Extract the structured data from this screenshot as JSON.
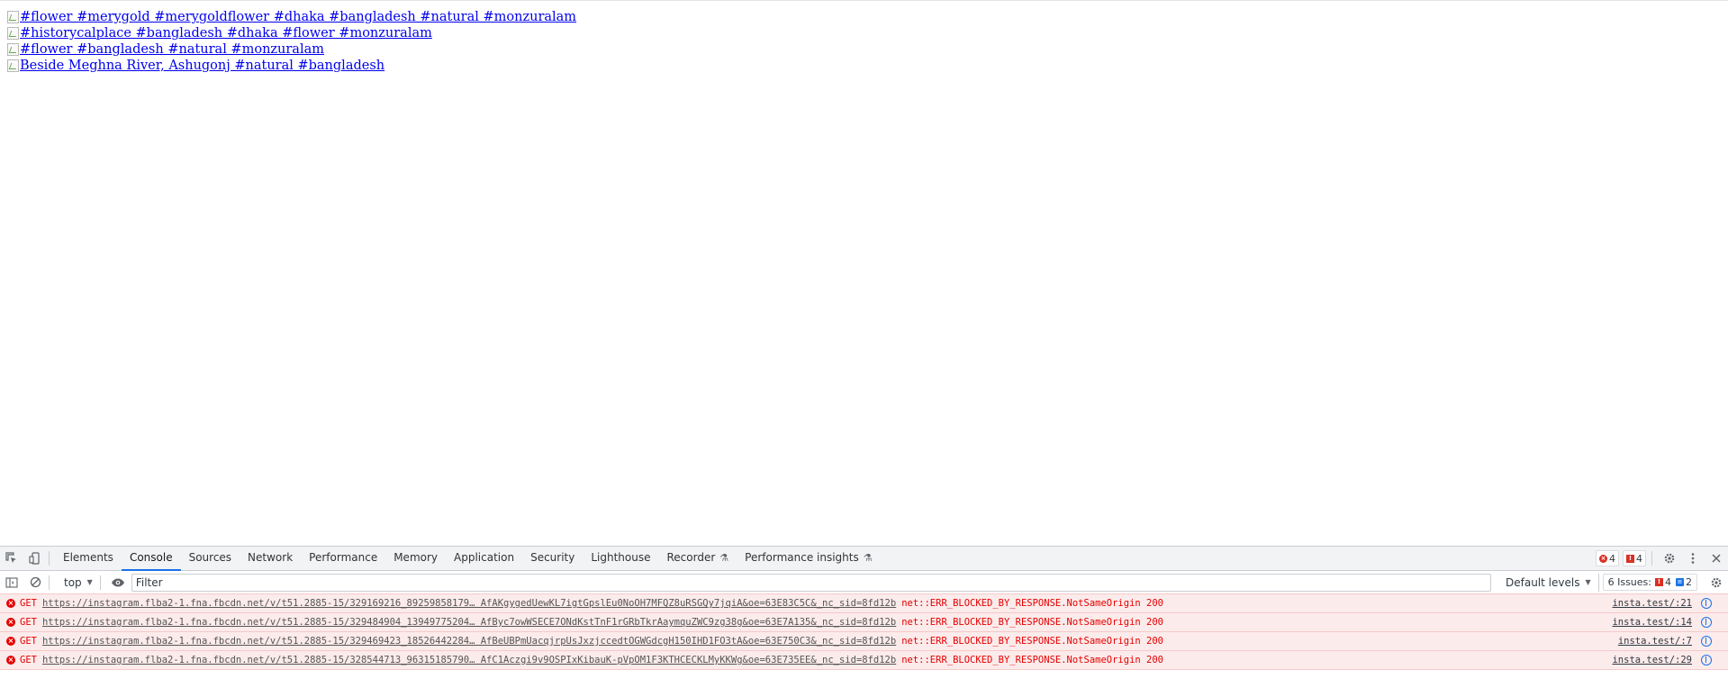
{
  "page": {
    "links": [
      {
        "alt": "#flower #merygold #merygoldflower #dhaka #bangladesh #natural #monzuralam"
      },
      {
        "alt": "#historycalplace #bangladesh #dhaka #flower #monzuralam"
      },
      {
        "alt": "#flower #bangladesh #natural #monzuralam"
      },
      {
        "alt": "Beside Meghna River, Ashugonj #natural #bangladesh"
      }
    ]
  },
  "devtools": {
    "tabs": [
      {
        "label": "Elements"
      },
      {
        "label": "Console"
      },
      {
        "label": "Sources"
      },
      {
        "label": "Network"
      },
      {
        "label": "Performance"
      },
      {
        "label": "Memory"
      },
      {
        "label": "Application"
      },
      {
        "label": "Security"
      },
      {
        "label": "Lighthouse"
      },
      {
        "label": "Recorder"
      },
      {
        "label": "Performance insights"
      }
    ],
    "active_tab": "Console",
    "error_count": "4",
    "issue_flag_count": "4",
    "toolbar": {
      "context": "top",
      "filter_placeholder": "Filter",
      "levels": "Default levels",
      "issues_label": "6 Issues:",
      "issues_errors": "4",
      "issues_info": "2"
    },
    "colors": {
      "accent": "#1a73e8",
      "error": "#e50000",
      "error_bg": "#fcebeb"
    },
    "messages": [
      {
        "method": "GET",
        "url": "https://instagram.flba2-1.fna.fbcdn.net/v/t51.2885-15/329169216_89259858179… AfAKgygedUewKL7igtGpslEu0NoOH7MFQZ8uRSGQy7jqiA&oe=63E83C5C&_nc_sid=8fd12b",
        "error": "net::ERR_BLOCKED_BY_RESPONSE.NotSameOrigin 200",
        "source": "insta.test/:21"
      },
      {
        "method": "GET",
        "url": "https://instagram.flba2-1.fna.fbcdn.net/v/t51.2885-15/329484904_13949775204… AfByc7owWSECE7ONdKstTnF1rGRbTkrAaymquZWC9zg38g&oe=63E7A135&_nc_sid=8fd12b",
        "error": "net::ERR_BLOCKED_BY_RESPONSE.NotSameOrigin 200",
        "source": "insta.test/:14"
      },
      {
        "method": "GET",
        "url": "https://instagram.flba2-1.fna.fbcdn.net/v/t51.2885-15/329469423_18526442284… AfBeUBPmUacqjrpUsJxzjccedtOGWGdcgH150IHD1FO3tA&oe=63E750C3&_nc_sid=8fd12b",
        "error": "net::ERR_BLOCKED_BY_RESPONSE.NotSameOrigin 200",
        "source": "insta.test/:7"
      },
      {
        "method": "GET",
        "url": "https://instagram.flba2-1.fna.fbcdn.net/v/t51.2885-15/328544713_96315185790… AfC1Aczgi9v9OSPIxKibauK-pVpOM1F3KTHCECKLMyKKWg&oe=63E735EE&_nc_sid=8fd12b",
        "error": "net::ERR_BLOCKED_BY_RESPONSE.NotSameOrigin 200",
        "source": "insta.test/:29"
      }
    ]
  }
}
